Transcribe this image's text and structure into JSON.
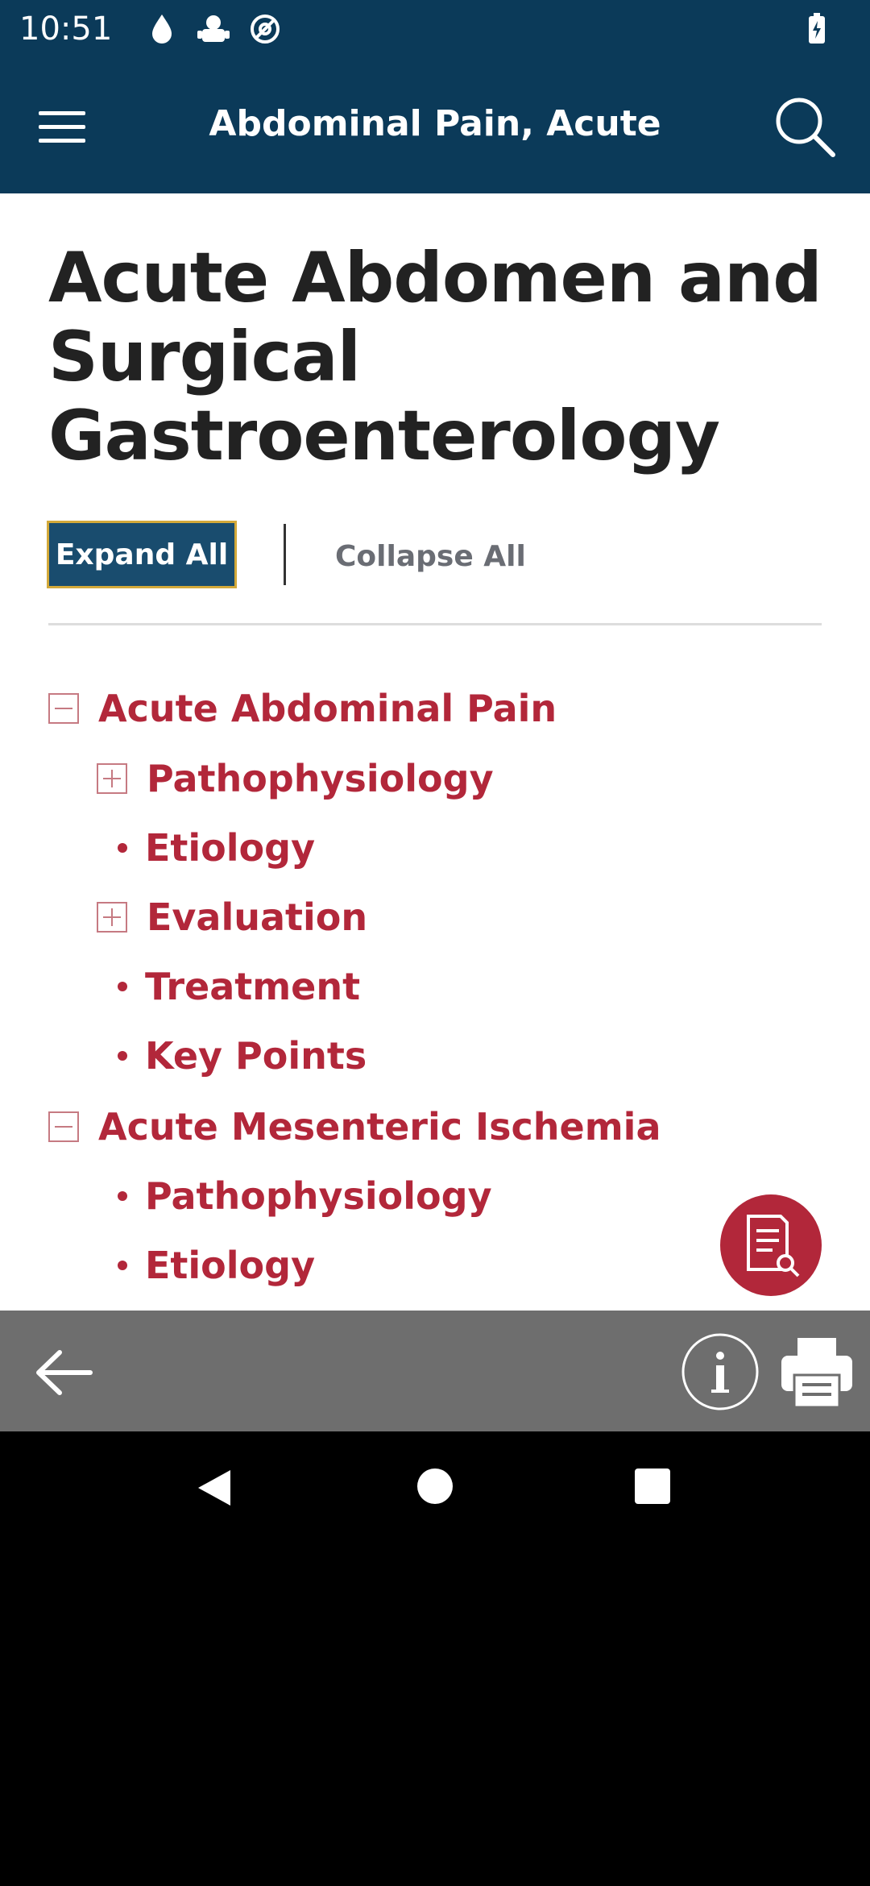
{
  "status_bar": {
    "time": "10:51",
    "icons": [
      "drop-icon",
      "android-icon",
      "at-icon"
    ],
    "battery": "battery-charging-icon"
  },
  "app_bar": {
    "title": "Abdominal Pain, Acute",
    "menu_icon": "hamburger-menu-icon",
    "search_icon": "search-icon"
  },
  "page": {
    "title": "Acute Abdomen and Surgical Gastroenterology",
    "expand_label": "Expand All",
    "collapse_label": "Collapse All"
  },
  "toc": [
    {
      "label": "Acute Abdominal Pain",
      "level": 0,
      "marker": "minus"
    },
    {
      "label": "Pathophysiology",
      "level": 1,
      "marker": "plus"
    },
    {
      "label": "Etiology",
      "level": 1,
      "marker": "bullet"
    },
    {
      "label": "Evaluation",
      "level": 1,
      "marker": "plus"
    },
    {
      "label": "Treatment",
      "level": 1,
      "marker": "bullet"
    },
    {
      "label": "Key Points",
      "level": 1,
      "marker": "bullet"
    },
    {
      "label": "Acute Mesenteric Ischemia",
      "level": 0,
      "marker": "minus"
    },
    {
      "label": "Pathophysiology",
      "level": 1,
      "marker": "bullet"
    },
    {
      "label": "Etiology",
      "level": 1,
      "marker": "bullet"
    }
  ],
  "colors": {
    "header": "#0b3a59",
    "link": "#b2273a",
    "expand_bg": "#194c6e",
    "expand_border": "#d3a93a",
    "bottom_bar": "#6e6e6e"
  },
  "bottom_bar": {
    "back_icon": "arrow-left-icon",
    "info_icon": "info-icon",
    "print_icon": "printer-icon"
  }
}
